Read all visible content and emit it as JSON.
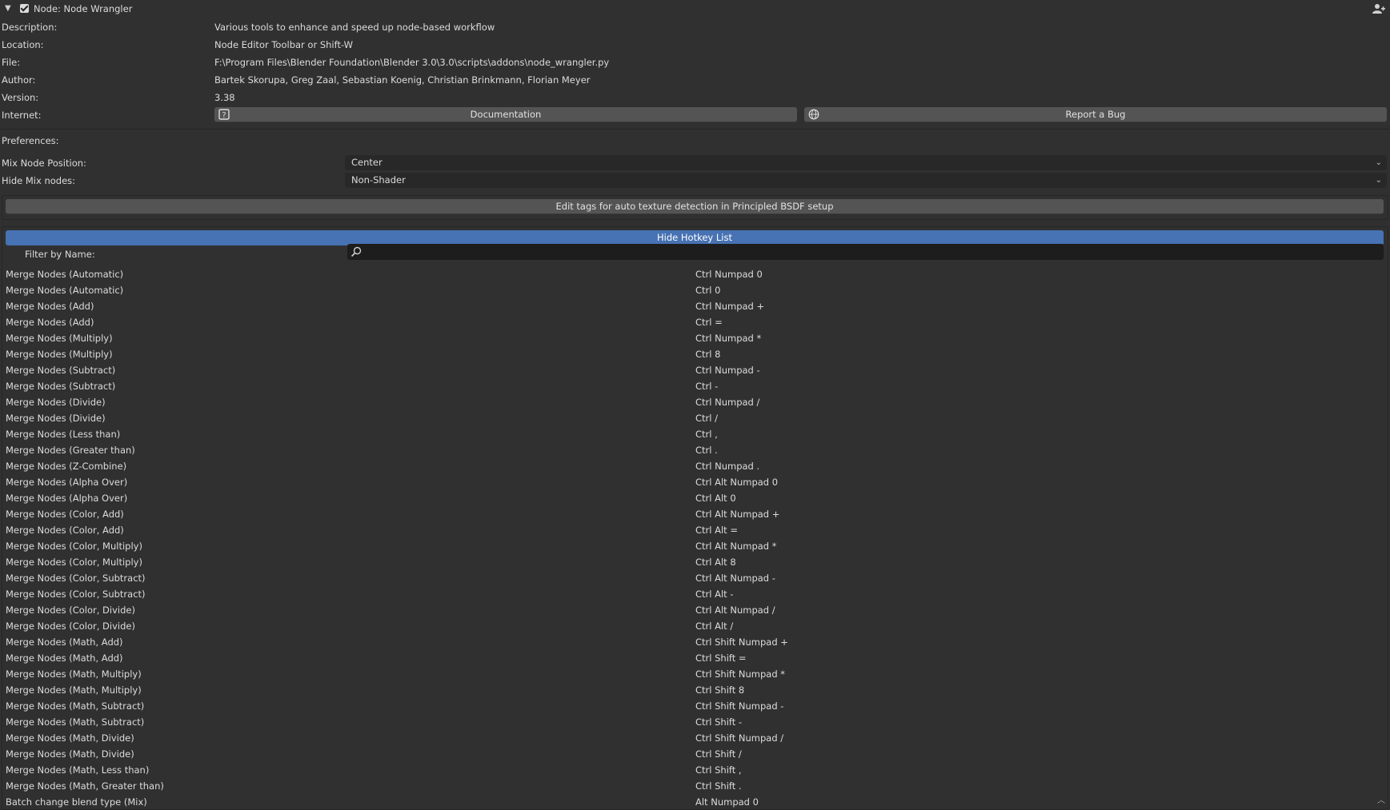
{
  "addon": {
    "title": "Node: Node Wrangler",
    "enabled": true
  },
  "info": {
    "description_label": "Description:",
    "description": "Various tools to enhance and speed up node-based workflow",
    "location_label": "Location:",
    "location": "Node Editor Toolbar or Shift-W",
    "file_label": "File:",
    "file": "F:\\Program Files\\Blender Foundation\\Blender 3.0\\3.0\\scripts\\addons\\node_wrangler.py",
    "author_label": "Author:",
    "author": "Bartek Skorupa, Greg Zaal, Sebastian Koenig, Christian Brinkmann, Florian Meyer",
    "version_label": "Version:",
    "version": "3.38",
    "internet_label": "Internet:",
    "documentation_button": "Documentation",
    "report_bug_button": "Report a Bug"
  },
  "preferences": {
    "label": "Preferences:",
    "mix_node_position_label": "Mix Node Position:",
    "mix_node_position_value": "Center",
    "hide_mix_nodes_label": "Hide Mix nodes:",
    "hide_mix_nodes_value": "Non-Shader",
    "edit_tags_button": "Edit tags for auto texture detection in Principled BSDF setup"
  },
  "hotkeys": {
    "toggle_button": "Hide Hotkey List",
    "filter_label": "Filter by Name:",
    "filter_value": "",
    "items": [
      {
        "name": "Merge Nodes (Automatic)",
        "key": "Ctrl Numpad 0"
      },
      {
        "name": "Merge Nodes (Automatic)",
        "key": "Ctrl 0"
      },
      {
        "name": "Merge Nodes (Add)",
        "key": "Ctrl Numpad +"
      },
      {
        "name": "Merge Nodes (Add)",
        "key": "Ctrl ="
      },
      {
        "name": "Merge Nodes (Multiply)",
        "key": "Ctrl Numpad *"
      },
      {
        "name": "Merge Nodes (Multiply)",
        "key": "Ctrl 8"
      },
      {
        "name": "Merge Nodes (Subtract)",
        "key": "Ctrl Numpad -"
      },
      {
        "name": "Merge Nodes (Subtract)",
        "key": "Ctrl -"
      },
      {
        "name": "Merge Nodes (Divide)",
        "key": "Ctrl Numpad /"
      },
      {
        "name": "Merge Nodes (Divide)",
        "key": "Ctrl /"
      },
      {
        "name": "Merge Nodes (Less than)",
        "key": "Ctrl ,"
      },
      {
        "name": "Merge Nodes (Greater than)",
        "key": "Ctrl ."
      },
      {
        "name": "Merge Nodes (Z-Combine)",
        "key": "Ctrl Numpad ."
      },
      {
        "name": "Merge Nodes (Alpha Over)",
        "key": "Ctrl Alt Numpad 0"
      },
      {
        "name": "Merge Nodes (Alpha Over)",
        "key": "Ctrl Alt 0"
      },
      {
        "name": "Merge Nodes (Color, Add)",
        "key": "Ctrl Alt Numpad +"
      },
      {
        "name": "Merge Nodes (Color, Add)",
        "key": "Ctrl Alt ="
      },
      {
        "name": "Merge Nodes (Color, Multiply)",
        "key": "Ctrl Alt Numpad *"
      },
      {
        "name": "Merge Nodes (Color, Multiply)",
        "key": "Ctrl Alt 8"
      },
      {
        "name": "Merge Nodes (Color, Subtract)",
        "key": "Ctrl Alt Numpad -"
      },
      {
        "name": "Merge Nodes (Color, Subtract)",
        "key": "Ctrl Alt -"
      },
      {
        "name": "Merge Nodes (Color, Divide)",
        "key": "Ctrl Alt Numpad /"
      },
      {
        "name": "Merge Nodes (Color, Divide)",
        "key": "Ctrl Alt /"
      },
      {
        "name": "Merge Nodes (Math, Add)",
        "key": "Ctrl Shift Numpad +"
      },
      {
        "name": "Merge Nodes (Math, Add)",
        "key": "Ctrl Shift ="
      },
      {
        "name": "Merge Nodes (Math, Multiply)",
        "key": "Ctrl Shift Numpad *"
      },
      {
        "name": "Merge Nodes (Math, Multiply)",
        "key": "Ctrl Shift 8"
      },
      {
        "name": "Merge Nodes (Math, Subtract)",
        "key": "Ctrl Shift Numpad -"
      },
      {
        "name": "Merge Nodes (Math, Subtract)",
        "key": "Ctrl Shift -"
      },
      {
        "name": "Merge Nodes (Math, Divide)",
        "key": "Ctrl Shift Numpad /"
      },
      {
        "name": "Merge Nodes (Math, Divide)",
        "key": "Ctrl Shift /"
      },
      {
        "name": "Merge Nodes (Math, Less than)",
        "key": "Ctrl Shift ,"
      },
      {
        "name": "Merge Nodes (Math, Greater than)",
        "key": "Ctrl Shift ."
      },
      {
        "name": "Batch change blend type (Mix)",
        "key": "Alt Numpad 0"
      }
    ]
  }
}
